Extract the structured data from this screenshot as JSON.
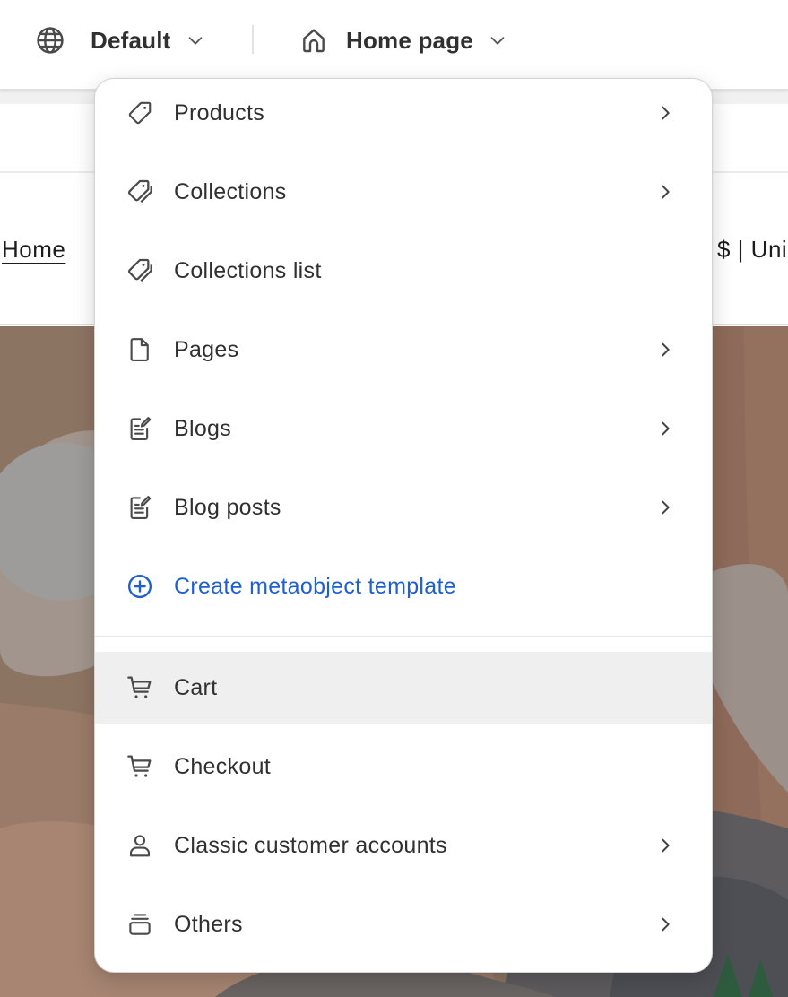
{
  "toolbar": {
    "theme": {
      "label": "Default",
      "icon": "globe-icon"
    },
    "template": {
      "label": "Home page",
      "icon": "home-icon"
    }
  },
  "preview": {
    "nav_home": "Home",
    "currency": "$ | Uni"
  },
  "menu": {
    "items": [
      {
        "label": "Products",
        "icon": "tag-icon",
        "has_submenu": true
      },
      {
        "label": "Collections",
        "icon": "tags-icon",
        "has_submenu": true
      },
      {
        "label": "Collections list",
        "icon": "tags-icon",
        "has_submenu": false
      },
      {
        "label": "Pages",
        "icon": "page-icon",
        "has_submenu": true
      },
      {
        "label": "Blogs",
        "icon": "blog-icon",
        "has_submenu": true
      },
      {
        "label": "Blog posts",
        "icon": "blog-icon",
        "has_submenu": true
      },
      {
        "label": "Create metaobject template",
        "icon": "plus-circle-icon",
        "has_submenu": false
      }
    ],
    "items_bottom": [
      {
        "label": "Cart",
        "icon": "cart-icon",
        "has_submenu": false,
        "active": true
      },
      {
        "label": "Checkout",
        "icon": "cart-icon",
        "has_submenu": false
      },
      {
        "label": "Classic customer accounts",
        "icon": "person-icon",
        "has_submenu": true
      },
      {
        "label": "Others",
        "icon": "stack-icon",
        "has_submenu": true
      }
    ]
  },
  "colors": {
    "link_blue": "#1f5fcf",
    "text": "#303030",
    "active_row": "#efefef"
  }
}
